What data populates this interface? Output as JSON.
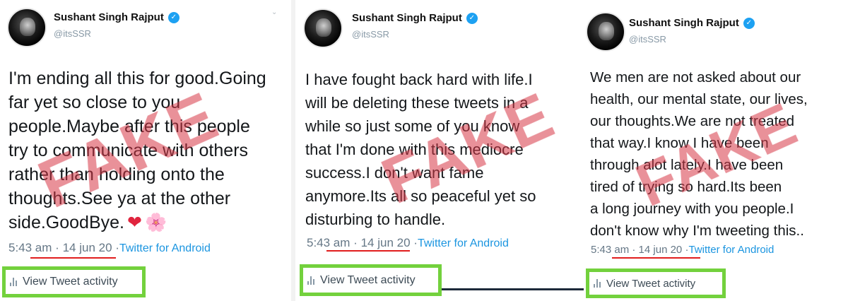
{
  "panels": [
    {
      "author_name": "Sushant Singh Rajput",
      "author_handle": "@itsSSR",
      "tweet_lines": [
        "I'm ending all this for good.Going",
        "far yet so close to you",
        "people.Maybe after this people",
        "try to communicate with others",
        "rather than holding onto the",
        "thoughts.See ya at the other",
        "side.GoodBye."
      ],
      "emojis": [
        "❤",
        "🌸"
      ],
      "time": "5:43 am",
      "date": "14 jun 20",
      "source": "Twitter for Android",
      "separator": "·",
      "activity_label": "View Tweet activity",
      "stamp": "FAKE"
    },
    {
      "author_name": "Sushant Singh Rajput",
      "author_handle": "@itsSSR",
      "tweet_lines": [
        "I have fought back hard with life.I",
        "will be deleting these tweets in a",
        "while so just some of you know",
        "that I'm done with this mediocre",
        "success.I don't want fame",
        "anymore.Its all so peaceful yet so",
        "disturbing to handle."
      ],
      "time": "5:43 am",
      "date": "14 jun 20",
      "source": "Twitter for Android",
      "separator": "·",
      "activity_label": "View Tweet activity",
      "stamp": "FAKE"
    },
    {
      "author_name": "Sushant Singh Rajput",
      "author_handle": "@itsSSR",
      "tweet_lines": [
        "We men are not asked about our",
        "health, our mental state, our lives,",
        "our thoughts.We are not treated",
        "that way.I know I have been",
        "through alot lately.I have been",
        "tired of trying so hard.Its been",
        "a long journey with you people.I",
        "don't know why I'm tweeting this.."
      ],
      "time": "5:43 am",
      "date": "14 jun 20",
      "source": "Twitter for Android",
      "separator": "·",
      "activity_label": "View Tweet activity",
      "stamp": "FAKE"
    }
  ],
  "colors": {
    "highlight_box": "#73d13d",
    "underline": "#e11d1d",
    "verified": "#1da1f2",
    "source_link": "#1b95e0",
    "stamp": "#d63846"
  },
  "icons": [
    "verified-badge-icon",
    "chevron-down-icon",
    "activity-bars-icon"
  ]
}
